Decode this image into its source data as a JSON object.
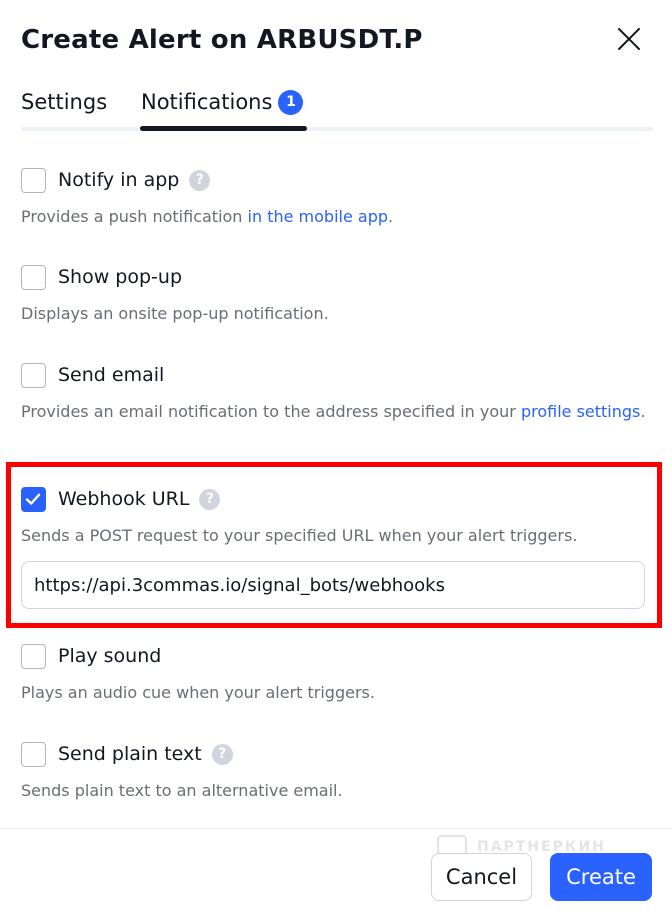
{
  "dialog": {
    "title": "Create Alert on ARBUSDT.P",
    "close_icon": "close-icon"
  },
  "tabs": [
    {
      "label": "Settings",
      "active": false
    },
    {
      "label": "Notifications",
      "active": true,
      "badge": "1"
    }
  ],
  "options": {
    "notify_in_app": {
      "label": "Notify in app",
      "checked": false,
      "desc_prefix": "Provides a push notification ",
      "desc_link": "in the mobile app",
      "desc_suffix": "."
    },
    "show_popup": {
      "label": "Show pop-up",
      "checked": false,
      "desc": "Displays an onsite pop-up notification."
    },
    "send_email": {
      "label": "Send email",
      "checked": false,
      "desc_prefix": "Provides an email notification to the address specified in your ",
      "desc_link": "profile settings",
      "desc_suffix": "."
    },
    "webhook_url": {
      "label": "Webhook URL",
      "checked": true,
      "desc": "Sends a POST request to your specified URL when your alert triggers.",
      "value": "https://api.3commas.io/signal_bots/webhooks"
    },
    "play_sound": {
      "label": "Play sound",
      "checked": false,
      "desc": "Plays an audio cue when your alert triggers."
    },
    "send_plain_text": {
      "label": "Send plain text",
      "checked": false,
      "desc": "Sends plain text to an alternative email."
    }
  },
  "help_glyph": "?",
  "footer": {
    "cancel_label": "Cancel",
    "create_label": "Create",
    "watermark_text": "ПАРТНЕРКИН"
  },
  "colors": {
    "accent": "#2962ff",
    "highlight": "#ff0000",
    "text": "#131722",
    "muted": "#6a6d78"
  }
}
